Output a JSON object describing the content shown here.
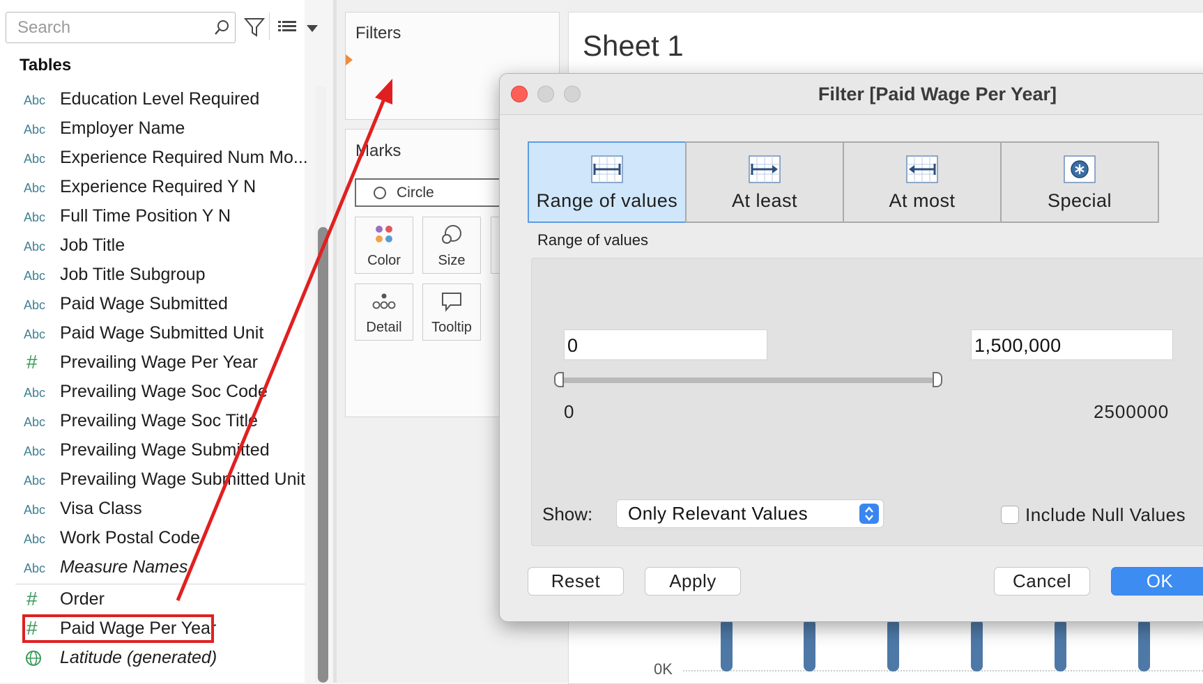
{
  "data_pane": {
    "search_placeholder": "Search",
    "tables_heading": "Tables",
    "fields": [
      {
        "type": "Abc",
        "label": "Education Level Required"
      },
      {
        "type": "Abc",
        "label": "Employer Name"
      },
      {
        "type": "Abc",
        "label": "Experience Required Num Mo..."
      },
      {
        "type": "Abc",
        "label": "Experience Required Y N"
      },
      {
        "type": "Abc",
        "label": "Full Time Position Y N"
      },
      {
        "type": "Abc",
        "label": "Job Title"
      },
      {
        "type": "Abc",
        "label": "Job Title Subgroup"
      },
      {
        "type": "Abc",
        "label": "Paid Wage Submitted"
      },
      {
        "type": "Abc",
        "label": "Paid Wage Submitted Unit"
      },
      {
        "type": "#",
        "label": "Prevailing Wage Per Year"
      },
      {
        "type": "Abc",
        "label": "Prevailing Wage Soc Code"
      },
      {
        "type": "Abc",
        "label": "Prevailing Wage Soc Title"
      },
      {
        "type": "Abc",
        "label": "Prevailing Wage Submitted"
      },
      {
        "type": "Abc",
        "label": "Prevailing Wage Submitted Unit"
      },
      {
        "type": "Abc",
        "label": "Visa Class"
      },
      {
        "type": "Abc",
        "label": "Work Postal Code"
      },
      {
        "type": "Abc",
        "label": "Measure Names"
      },
      {
        "type": "#",
        "label": "Order"
      },
      {
        "type": "#",
        "label": "Paid Wage Per Year"
      },
      {
        "type": "globe",
        "label": "Latitude (generated)"
      }
    ]
  },
  "shelves": {
    "filters_title": "Filters",
    "marks_title": "Marks",
    "mark_type": "Circle",
    "color_label": "Color",
    "size_label": "Size",
    "detail_label": "Detail",
    "tooltip_label": "Tooltip"
  },
  "sheet": {
    "title": "Sheet 1",
    "axis_label": "0K"
  },
  "dialog": {
    "title": "Filter [Paid Wage Per Year]",
    "tabs": [
      "Range of values",
      "At least",
      "At most",
      "Special"
    ],
    "section_label": "Range of values",
    "min_value": "0",
    "max_value": "1,500,000",
    "range_min_label": "0",
    "range_max_label": "2500000",
    "show_label": "Show:",
    "show_value": "Only Relevant Values",
    "include_null_label": "Include Null Values",
    "reset_label": "Reset",
    "apply_label": "Apply",
    "cancel_label": "Cancel",
    "ok_label": "OK"
  },
  "colors": {
    "highlight": "#e02020",
    "selected_tab": "#d0e6fb",
    "ok_button": "#3d8cf2",
    "bar": "#4e79a7",
    "close_light": "#fe5f57"
  }
}
